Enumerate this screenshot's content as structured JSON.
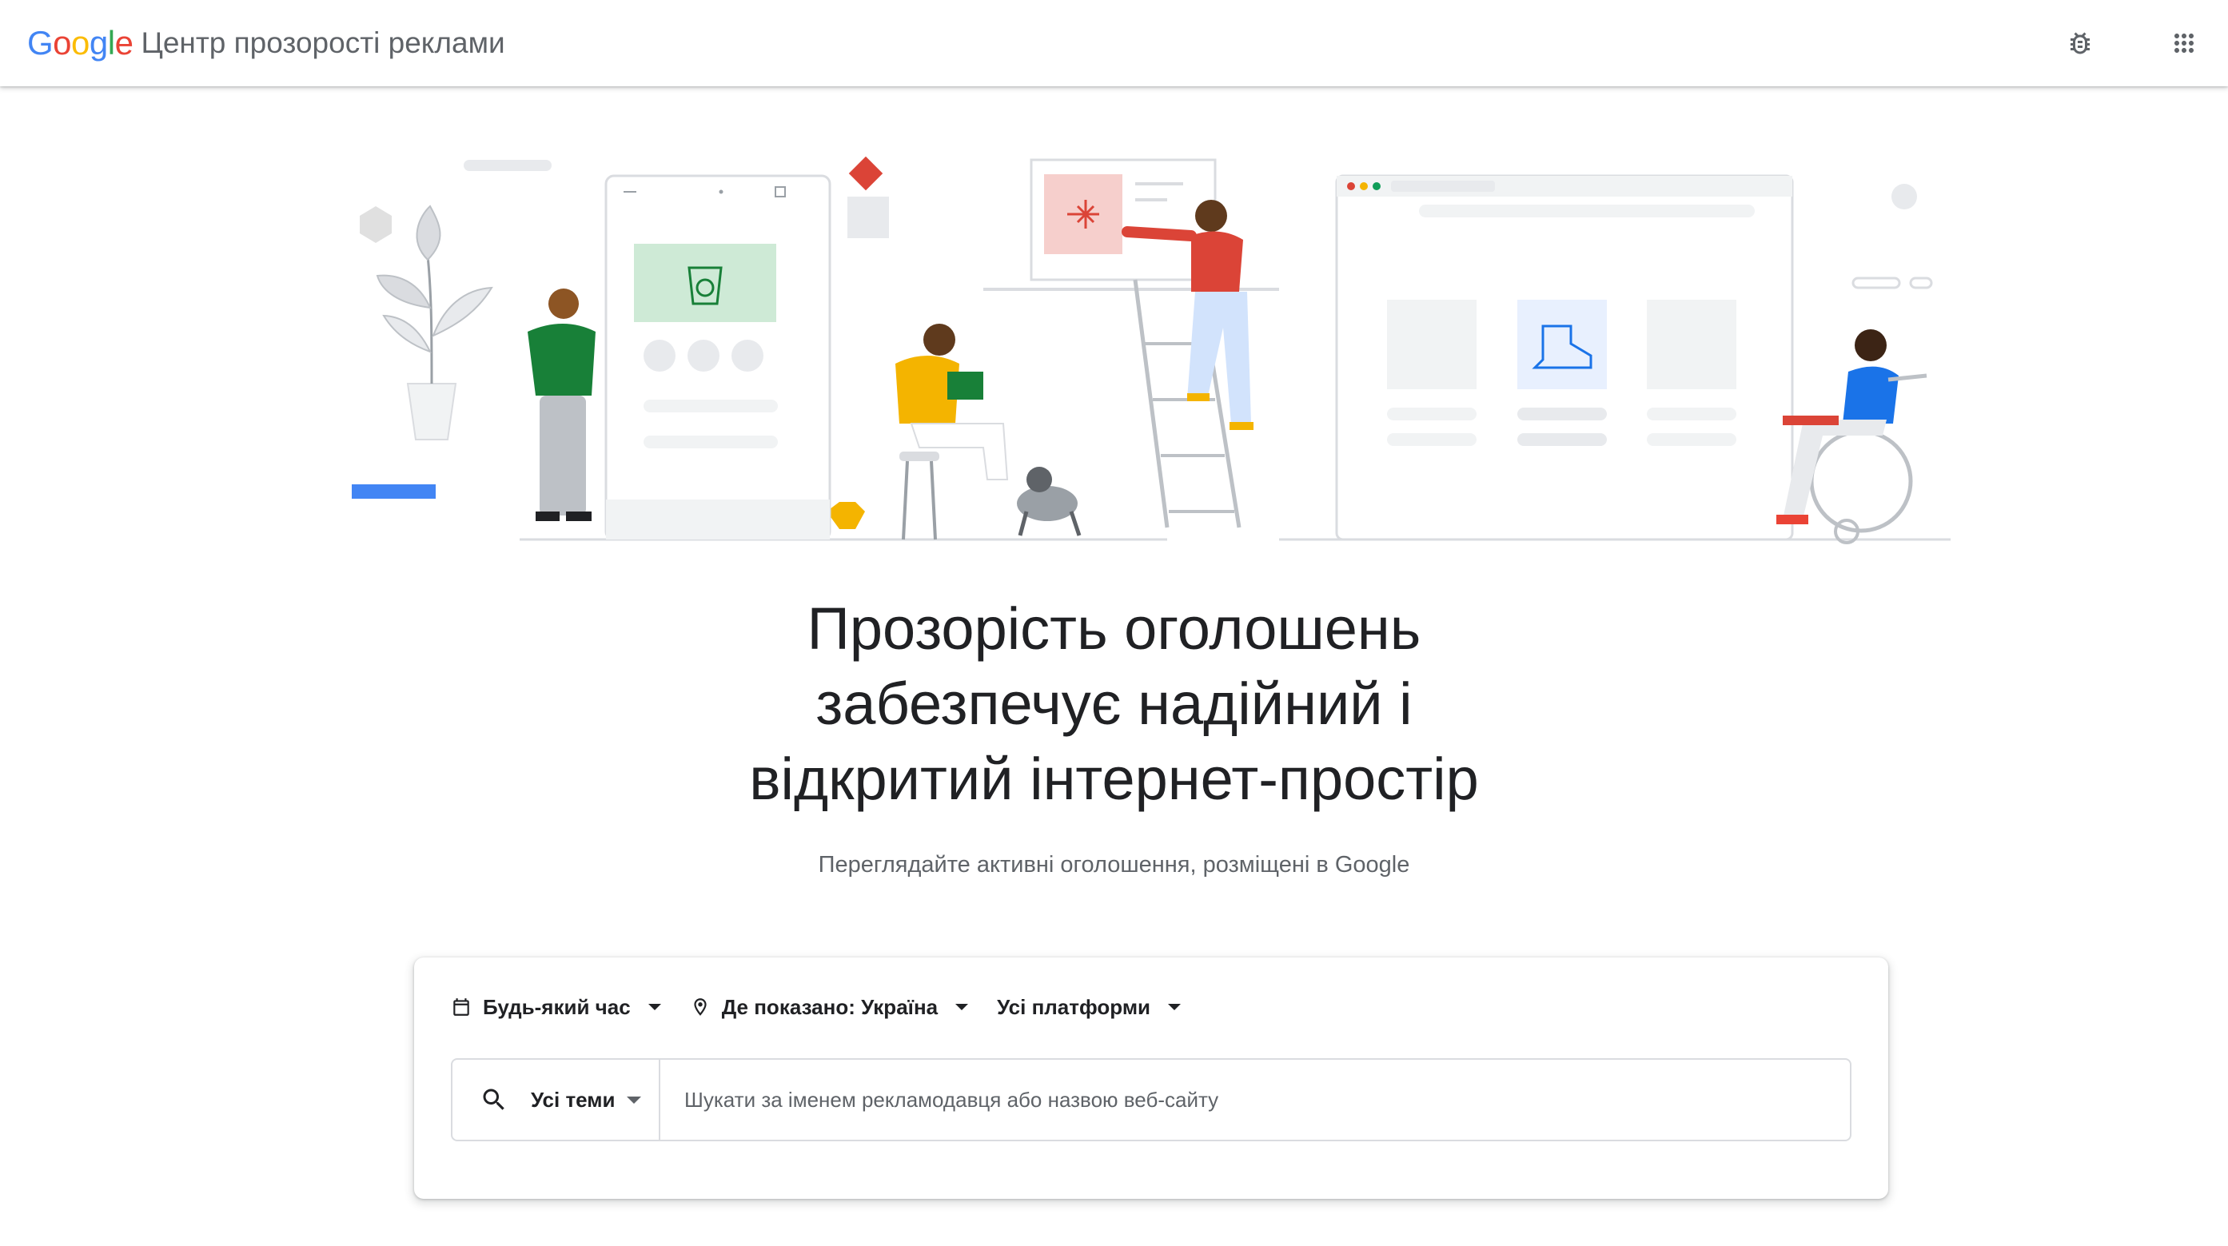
{
  "header": {
    "logo_letters": [
      {
        "char": "G",
        "color": "#4285F4"
      },
      {
        "char": "o",
        "color": "#EA4335"
      },
      {
        "char": "o",
        "color": "#FBBC05"
      },
      {
        "char": "g",
        "color": "#4285F4"
      },
      {
        "char": "l",
        "color": "#34A853"
      },
      {
        "char": "e",
        "color": "#EA4335"
      }
    ],
    "title": "Центр прозорості реклами",
    "actions": [
      {
        "name": "bug-report-icon"
      },
      {
        "name": "apps-grid-icon"
      }
    ]
  },
  "hero": {
    "headline_lines": [
      "Прозорість оголошень",
      "забезпечує надійний і",
      "відкритий інтернет-простір"
    ],
    "subtitle": "Переглядайте активні оголошення, розміщені в Google"
  },
  "search_card": {
    "filters": {
      "time": {
        "label": "Будь-який час",
        "icon": "calendar-icon"
      },
      "location": {
        "label": "Де показано: Україна",
        "icon": "location-pin-icon"
      },
      "platform": {
        "label": "Усі платформи"
      }
    },
    "topic_select": {
      "label": "Усі теми",
      "icon": "search-icon"
    },
    "search": {
      "placeholder": "Шукати за іменем рекламодавця або назвою веб-сайту",
      "value": ""
    }
  },
  "colors": {
    "brand_blue": "#4285F4",
    "brand_red": "#EA4335",
    "brand_yellow": "#FBBC05",
    "brand_green": "#34A853",
    "text_primary": "#202124",
    "text_secondary": "#5f6368",
    "border": "#dadce0"
  }
}
